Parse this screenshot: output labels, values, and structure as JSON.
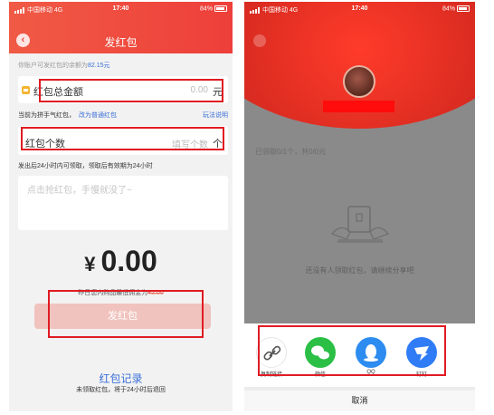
{
  "left": {
    "status": {
      "carrier": "中国移动",
      "network": "4G",
      "time": "17:40",
      "battery": "84%"
    },
    "title": "发红包",
    "balance_prefix": "你账户可发红包的余额为",
    "balance_value": "82.15元",
    "amount_field": {
      "label": "红包总金额",
      "placeholder": "0.00",
      "unit": "元"
    },
    "mode_text": "当前为拼手气红包，",
    "mode_link": "改为普通红包",
    "rules_link": "玩法说明",
    "count_field": {
      "label": "红包个数",
      "placeholder": "填写个数",
      "unit": "个"
    },
    "hint": "发出后24小时内可领取，领取后有效期为24小时",
    "message_placeholder": "点击抢红包，手慢就没了~",
    "currency": "¥",
    "amount": "0.00",
    "yesterday_prefix": "昨日您内购品最低佣金为",
    "yesterday_value": "¥2.00",
    "send_button": "发红包",
    "record_link": "红包记录",
    "record_sub": "未领取红包，将于24小时后退回"
  },
  "right": {
    "status": {
      "carrier": "中国移动",
      "network": "4G",
      "time": "17:40",
      "battery": "84%"
    },
    "progress": "已领取0/1个，共0/0元",
    "empty_text": "还没有人领取红包，请继续分享吧",
    "share_items": [
      {
        "label": "复制链接",
        "icon": "link-icon"
      },
      {
        "label": "微信",
        "icon": "wechat-icon"
      },
      {
        "label": "QQ",
        "icon": "qq-icon"
      },
      {
        "label": "钉钉",
        "icon": "dingtalk-icon"
      }
    ],
    "cancel": "取消"
  },
  "colors": {
    "brand_red": "#ee3f3a",
    "link_blue": "#3a6fd8",
    "annotation_red": "#e01b22"
  }
}
